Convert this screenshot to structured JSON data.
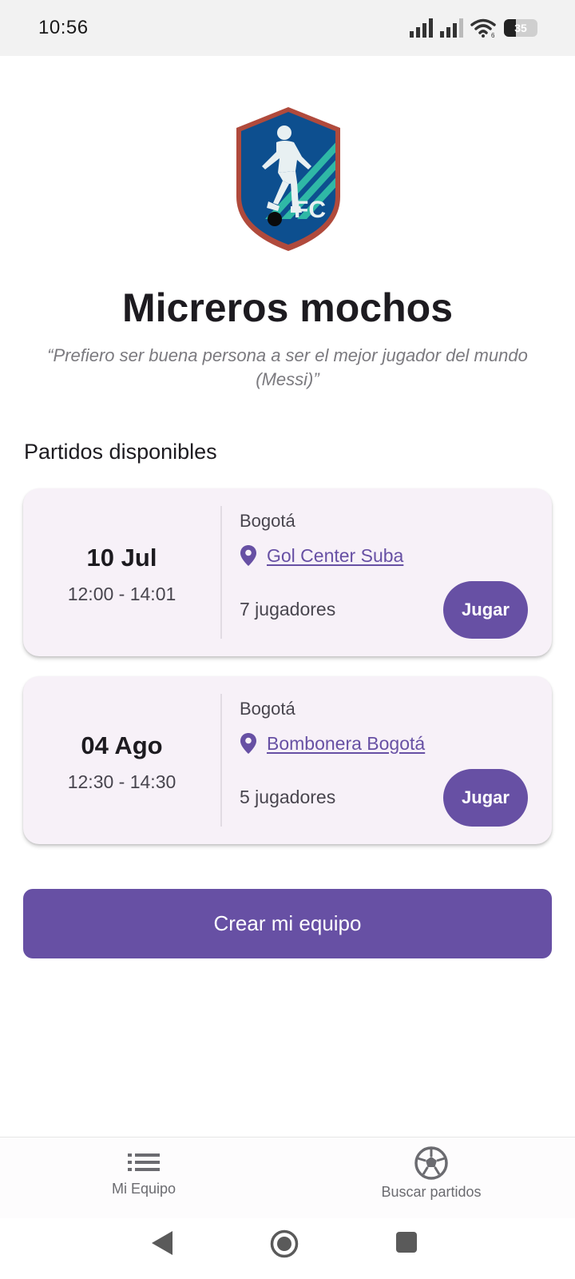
{
  "status_bar": {
    "time": "10:56",
    "battery": "35",
    "battery_level": 0.35
  },
  "team": {
    "crest_text": "FC",
    "name": "Micreros mochos",
    "quote": "“Prefiero ser buena persona a ser el mejor jugador del mundo (Messi)”"
  },
  "section_title": "Partidos disponibles",
  "matches": [
    {
      "date": "10 Jul",
      "time": "12:00 - 14:01",
      "city": "Bogotá",
      "venue": "Gol Center Suba",
      "players": "7 jugadores",
      "button": "Jugar"
    },
    {
      "date": "04 Ago",
      "time": "12:30 - 14:30",
      "city": "Bogotá",
      "venue": "Bombonera Bogotá",
      "players": "5 jugadores",
      "button": "Jugar"
    }
  ],
  "create_button": "Crear mi equipo",
  "bottom_nav": {
    "items": [
      {
        "label": "Mi Equipo",
        "icon": "list-icon"
      },
      {
        "label": "Buscar partidos",
        "icon": "soccer-ball-icon"
      }
    ]
  },
  "colors": {
    "primary": "#6750a4",
    "card_bg": "#f7f1f8",
    "crest_blue": "#0d4f8f",
    "crest_border": "#b04a3c",
    "crest_stripe": "#2fb8a6"
  }
}
